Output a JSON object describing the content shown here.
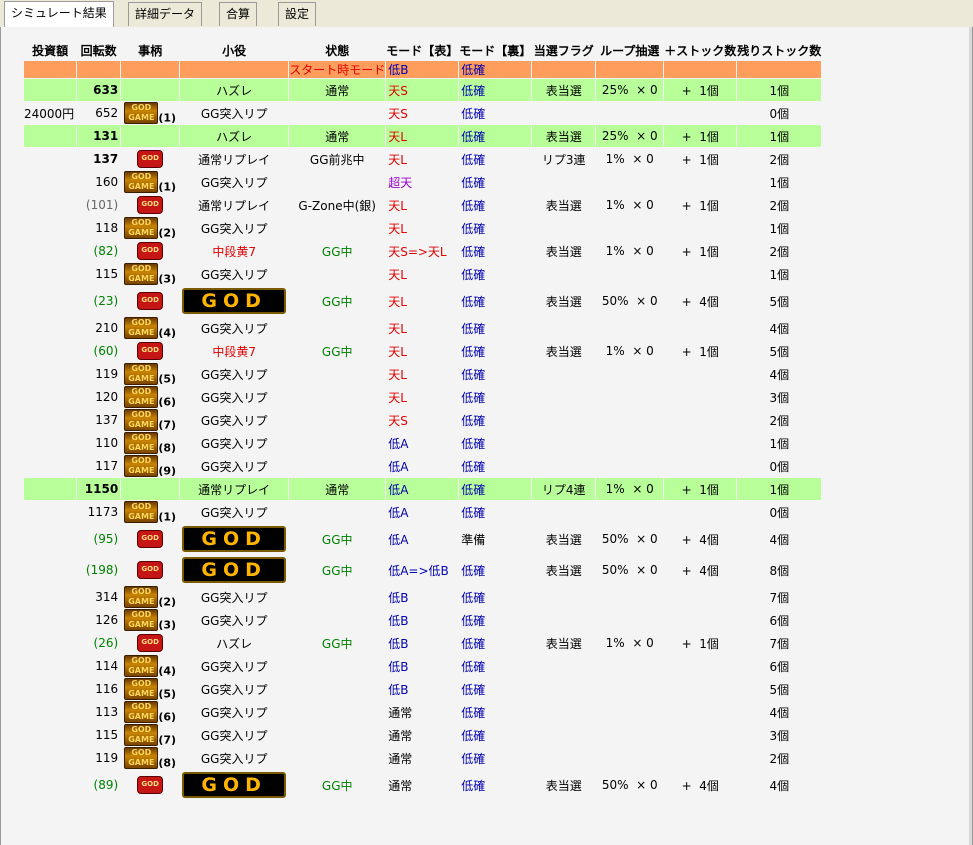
{
  "tabs": [
    {
      "label": "シミュレート結果",
      "active": true
    },
    {
      "label": "詳細データ",
      "active": false
    },
    {
      "label": "合算",
      "active": false
    },
    {
      "label": "設定",
      "active": false
    }
  ],
  "headers": [
    "投資額",
    "回転数",
    "事柄",
    "小役",
    "状態",
    "モード【表】",
    "モード【裏】",
    "当選フラグ",
    "ループ抽選",
    "＋ストック数",
    "残りストック数"
  ],
  "rows": [
    {
      "style": "orange",
      "koyaku": "",
      "state": "",
      "state_label": "スタート時モード",
      "mode_omote": "低B",
      "mode_ura": "低確"
    },
    {
      "style": "green",
      "kaiten": "633",
      "koyaku": "ハズレ",
      "state": "通常",
      "mode_omote": "天S",
      "mode_ura": "低確",
      "flag": "表当選",
      "loop": "25%",
      "times": "× 0",
      "plus": "+",
      "stock_add": "1個",
      "remain": "1個"
    },
    {
      "toushi": "24000円",
      "kaiten": "652",
      "icon": "gg",
      "gg_count": "(1)",
      "koyaku": "GG突入リプ",
      "mode_omote": "天S",
      "mode_ura": "低確",
      "remain": "0個"
    },
    {
      "style": "green",
      "kaiten": "131",
      "koyaku": "ハズレ",
      "state": "通常",
      "mode_omote": "天L",
      "mode_ura": "低確",
      "flag": "表当選",
      "loop": "25%",
      "times": "× 0",
      "plus": "+",
      "stock_add": "1個",
      "remain": "1個"
    },
    {
      "kaiten": "137",
      "bold": true,
      "icon": "red",
      "koyaku": "通常リプレイ",
      "state": "GG前兆中",
      "mode_omote": "天L",
      "mode_ura": "低確",
      "flag": "リプ3連",
      "loop": "1%",
      "times": "× 0",
      "plus": "+",
      "stock_add": "1個",
      "remain": "2個"
    },
    {
      "kaiten": "160",
      "icon": "gg",
      "gg_count": "(1)",
      "koyaku": "GG突入リプ",
      "mode_omote": "超天",
      "mode_ura": "低確",
      "remain": "1個"
    },
    {
      "kaiten": "(101)",
      "kaiten_color": "gray",
      "icon": "red",
      "koyaku": "通常リプレイ",
      "state": "G-Zone中(銀)",
      "mode_omote": "天L",
      "mode_ura": "低確",
      "flag": "表当選",
      "loop": "1%",
      "times": "× 0",
      "plus": "+",
      "stock_add": "1個",
      "remain": "2個"
    },
    {
      "kaiten": "118",
      "icon": "gg",
      "gg_count": "(2)",
      "koyaku": "GG突入リプ",
      "mode_omote": "天L",
      "mode_ura": "低確",
      "remain": "1個"
    },
    {
      "kaiten": "(82)",
      "kaiten_color": "green",
      "icon": "red",
      "koyaku": "中段黄7",
      "koyaku_color": "red",
      "state": "GG中",
      "state_color": "green",
      "mode_omote": "天S=>天L",
      "mode_ura": "低確",
      "flag": "表当選",
      "loop": "1%",
      "times": "× 0",
      "plus": "+",
      "stock_add": "1個",
      "remain": "2個"
    },
    {
      "kaiten": "115",
      "icon": "gg",
      "gg_count": "(3)",
      "koyaku": "GG突入リプ",
      "mode_omote": "天L",
      "mode_ura": "低確",
      "remain": "1個"
    },
    {
      "style": "tall",
      "kaiten": "(23)",
      "kaiten_color": "green",
      "icon": "red",
      "koyaku": "GOD",
      "koyaku_banner": true,
      "state": "GG中",
      "state_color": "green",
      "mode_omote": "天L",
      "mode_ura": "低確",
      "flag": "表当選",
      "loop": "50%",
      "times": "× 0",
      "plus": "+",
      "stock_add": "4個",
      "remain": "5個"
    },
    {
      "kaiten": "210",
      "icon": "gg",
      "gg_count": "(4)",
      "koyaku": "GG突入リプ",
      "mode_omote": "天L",
      "mode_ura": "低確",
      "remain": "4個"
    },
    {
      "kaiten": "(60)",
      "kaiten_color": "green",
      "icon": "red",
      "koyaku": "中段黄7",
      "koyaku_color": "red",
      "state": "GG中",
      "state_color": "green",
      "mode_omote": "天L",
      "mode_ura": "低確",
      "flag": "表当選",
      "loop": "1%",
      "times": "× 0",
      "plus": "+",
      "stock_add": "1個",
      "remain": "5個"
    },
    {
      "kaiten": "119",
      "icon": "gg",
      "gg_count": "(5)",
      "koyaku": "GG突入リプ",
      "mode_omote": "天L",
      "mode_ura": "低確",
      "remain": "4個"
    },
    {
      "kaiten": "120",
      "icon": "gg",
      "gg_count": "(6)",
      "koyaku": "GG突入リプ",
      "mode_omote": "天L",
      "mode_ura": "低確",
      "remain": "3個"
    },
    {
      "kaiten": "137",
      "icon": "gg",
      "gg_count": "(7)",
      "koyaku": "GG突入リプ",
      "mode_omote": "天S",
      "mode_ura": "低確",
      "remain": "2個"
    },
    {
      "kaiten": "110",
      "icon": "gg",
      "gg_count": "(8)",
      "koyaku": "GG突入リプ",
      "mode_omote": "低A",
      "mode_ura": "低確",
      "remain": "1個"
    },
    {
      "kaiten": "117",
      "icon": "gg",
      "gg_count": "(9)",
      "koyaku": "GG突入リプ",
      "mode_omote": "低A",
      "mode_ura": "低確",
      "remain": "0個"
    },
    {
      "style": "green",
      "kaiten": "1150",
      "koyaku": "通常リプレイ",
      "state": "通常",
      "mode_omote": "低A",
      "mode_ura": "低確",
      "flag": "リプ4連",
      "loop": "1%",
      "times": "× 0",
      "plus": "+",
      "stock_add": "1個",
      "remain": "1個"
    },
    {
      "kaiten": "1173",
      "icon": "gg",
      "gg_count": "(1)",
      "koyaku": "GG突入リプ",
      "mode_omote": "低A",
      "mode_ura": "低確",
      "remain": "0個"
    },
    {
      "style": "tall",
      "kaiten": "(95)",
      "kaiten_color": "green",
      "icon": "red",
      "koyaku": "GOD",
      "koyaku_banner": true,
      "state": "GG中",
      "state_color": "green",
      "mode_omote": "低A",
      "mode_ura": "準備",
      "ura_color": "black",
      "flag": "表当選",
      "loop": "50%",
      "times": "× 0",
      "plus": "+",
      "stock_add": "4個",
      "remain": "4個"
    },
    {
      "style": "tall",
      "kaiten": "(198)",
      "kaiten_color": "green",
      "icon": "red",
      "koyaku": "GOD",
      "koyaku_banner": true,
      "state": "GG中",
      "state_color": "green",
      "mode_omote": "低A=>低B",
      "mode_ura": "低確",
      "flag": "表当選",
      "loop": "50%",
      "times": "× 0",
      "plus": "+",
      "stock_add": "4個",
      "remain": "8個"
    },
    {
      "kaiten": "314",
      "icon": "gg",
      "gg_count": "(2)",
      "koyaku": "GG突入リプ",
      "mode_omote": "低B",
      "mode_ura": "低確",
      "remain": "7個"
    },
    {
      "kaiten": "126",
      "icon": "gg",
      "gg_count": "(3)",
      "koyaku": "GG突入リプ",
      "mode_omote": "低B",
      "mode_ura": "低確",
      "remain": "6個"
    },
    {
      "kaiten": "(26)",
      "kaiten_color": "green",
      "icon": "red",
      "koyaku": "ハズレ",
      "state": "GG中",
      "state_color": "green",
      "mode_omote": "低B",
      "mode_ura": "低確",
      "flag": "表当選",
      "loop": "1%",
      "times": "× 0",
      "plus": "+",
      "stock_add": "1個",
      "remain": "7個"
    },
    {
      "kaiten": "114",
      "icon": "gg",
      "gg_count": "(4)",
      "koyaku": "GG突入リプ",
      "mode_omote": "低B",
      "mode_ura": "低確",
      "remain": "6個"
    },
    {
      "kaiten": "116",
      "icon": "gg",
      "gg_count": "(5)",
      "koyaku": "GG突入リプ",
      "mode_omote": "低B",
      "mode_ura": "低確",
      "remain": "5個"
    },
    {
      "kaiten": "113",
      "icon": "gg",
      "gg_count": "(6)",
      "koyaku": "GG突入リプ",
      "mode_omote": "通常",
      "omote_color": "black",
      "mode_ura": "低確",
      "remain": "4個"
    },
    {
      "kaiten": "115",
      "icon": "gg",
      "gg_count": "(7)",
      "koyaku": "GG突入リプ",
      "mode_omote": "通常",
      "omote_color": "black",
      "mode_ura": "低確",
      "remain": "3個"
    },
    {
      "kaiten": "119",
      "icon": "gg",
      "gg_count": "(8)",
      "koyaku": "GG突入リプ",
      "mode_omote": "通常",
      "omote_color": "black",
      "mode_ura": "低確",
      "remain": "2個"
    },
    {
      "style": "tall",
      "kaiten": "(89)",
      "kaiten_color": "green",
      "icon": "red",
      "koyaku": "GOD",
      "koyaku_banner": true,
      "state": "GG中",
      "state_color": "green",
      "mode_omote": "通常",
      "omote_color": "black",
      "mode_ura": "低確",
      "flag": "表当選",
      "loop": "50%",
      "times": "× 0",
      "plus": "+",
      "stock_add": "4個",
      "remain": "4個"
    }
  ],
  "colors": {
    "highlight": "#b8ff9a",
    "start_row": "#ff9d5c",
    "mode_red": "#e00000",
    "mode_blue": "#0000b0",
    "gg_green": "#008000"
  }
}
